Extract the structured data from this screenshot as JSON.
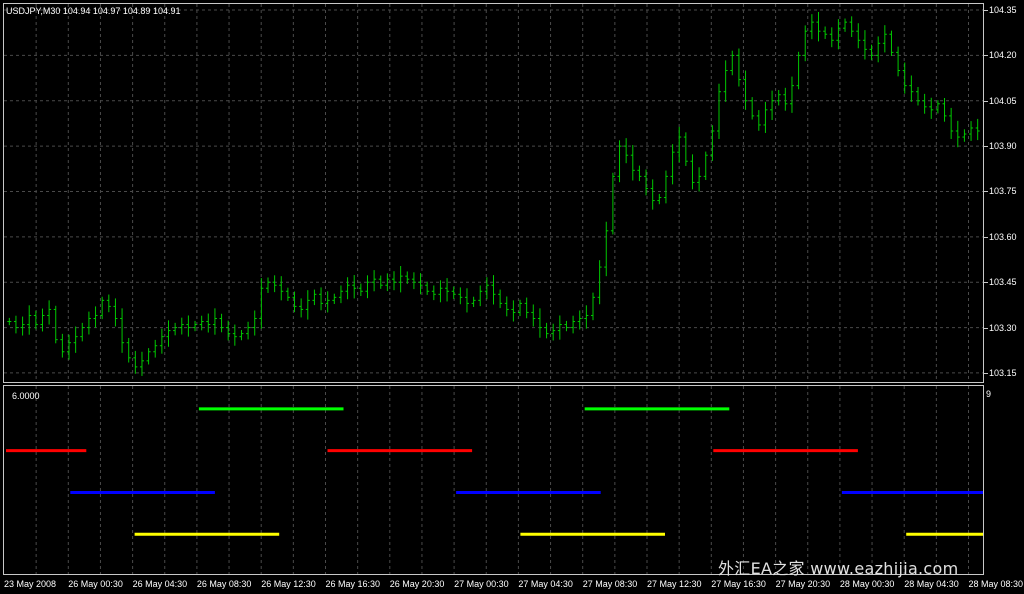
{
  "chart": {
    "title": "USDJPY,M30  104.94 104.97 104.89 104.91",
    "price_axis": [
      "104.35",
      "104.20",
      "104.05",
      "103.90",
      "103.75",
      "103.60",
      "103.45",
      "103.30",
      "103.15"
    ],
    "time_axis": [
      "23 May 2008",
      "26 May 00:30",
      "26 May 04:30",
      "26 May 08:30",
      "26 May 12:30",
      "26 May 16:30",
      "26 May 20:30",
      "27 May 00:30",
      "27 May 04:30",
      "27 May 08:30",
      "27 May 12:30",
      "27 May 16:30",
      "27 May 20:30",
      "28 May 00:30",
      "28 May 04:30",
      "28 May 08:30"
    ],
    "indicator_value": "6.0000",
    "indicator_max": "9",
    "watermark": "外汇EA之家 www.eazhijia.com"
  },
  "colors": {
    "bar": "#00c800",
    "green": "#00ff00",
    "red": "#ff0000",
    "blue": "#0000ff",
    "yellow": "#ffff00",
    "grid": "#4a4a4a",
    "frame": "#c8c8c8"
  },
  "chart_data": {
    "type": "ohlc",
    "instrument": "USDJPY",
    "timeframe": "M30",
    "ylim": [
      103.12,
      104.37
    ],
    "sessions": [
      {
        "color": "red",
        "level": 6,
        "ranges": [
          [
            "23 May 2008",
            "26 May 00:30"
          ],
          [
            "26 May 16:30",
            "27 May 00:30"
          ],
          [
            "27 May 16:30",
            "28 May 00:30"
          ]
        ]
      },
      {
        "color": "green",
        "level": 8,
        "ranges": [
          [
            "26 May 08:30",
            "26 May 16:30"
          ],
          [
            "27 May 08:30",
            "27 May 16:30"
          ]
        ]
      },
      {
        "color": "blue",
        "level": 4,
        "ranges": [
          [
            "26 May 00:30",
            "26 May 08:30"
          ],
          [
            "27 May 00:30",
            "27 May 08:30"
          ],
          [
            "28 May 00:30",
            "28 May 08:30"
          ]
        ]
      },
      {
        "color": "yellow",
        "level": 2,
        "ranges": [
          [
            "26 May 04:30",
            "26 May 12:30"
          ],
          [
            "27 May 04:30",
            "27 May 12:30"
          ],
          [
            "28 May 04:30",
            "28 May 08:30"
          ]
        ]
      }
    ],
    "closes": [
      103.32,
      103.3,
      103.31,
      103.34,
      103.31,
      103.34,
      103.36,
      103.26,
      103.22,
      103.25,
      103.27,
      103.3,
      103.33,
      103.34,
      103.39,
      103.37,
      103.33,
      103.25,
      103.2,
      103.17,
      103.19,
      103.22,
      103.24,
      103.27,
      103.29,
      103.3,
      103.31,
      103.3,
      103.31,
      103.32,
      103.31,
      103.33,
      103.3,
      103.28,
      103.27,
      103.28,
      103.3,
      103.33,
      103.43,
      103.45,
      103.44,
      103.42,
      103.4,
      103.37,
      103.36,
      103.39,
      103.41,
      103.38,
      103.39,
      103.4,
      103.42,
      103.44,
      103.43,
      103.42,
      103.45,
      103.46,
      103.44,
      103.46,
      103.45,
      103.47,
      103.46,
      103.45,
      103.44,
      103.42,
      103.41,
      103.43,
      103.42,
      103.41,
      103.4,
      103.38,
      103.39,
      103.42,
      103.44,
      103.41,
      103.38,
      103.36,
      103.35,
      103.38,
      103.35,
      103.33,
      103.3,
      103.28,
      103.29,
      103.31,
      103.3,
      103.32,
      103.33,
      103.34,
      103.4,
      103.5,
      103.62,
      103.8,
      103.9,
      103.87,
      103.82,
      103.8,
      103.76,
      103.72,
      103.73,
      103.8,
      103.88,
      103.93,
      103.85,
      103.78,
      103.8,
      103.87,
      103.95,
      104.08,
      104.15,
      104.2,
      104.12,
      104.05,
      104.0,
      103.97,
      104.02,
      104.05,
      104.07,
      104.04,
      104.1,
      104.2,
      104.28,
      104.31,
      104.28,
      104.27,
      104.25,
      104.29,
      104.31,
      104.28,
      104.25,
      104.22,
      104.2,
      104.24,
      104.27,
      104.21,
      104.15,
      104.1,
      104.08,
      104.05,
      104.03,
      104.02,
      104.04,
      104.0,
      103.95,
      103.93,
      103.94,
      103.96,
      103.95
    ]
  }
}
